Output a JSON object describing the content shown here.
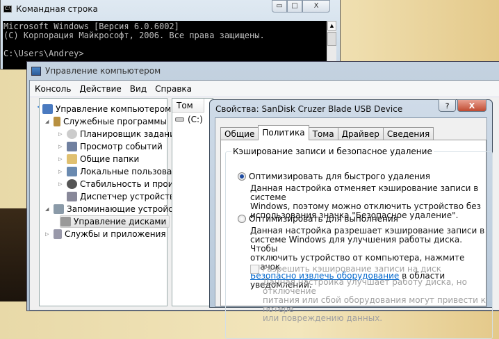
{
  "cmd": {
    "title": "Командная строка",
    "icon_text": "C:\\",
    "lines": [
      "Microsoft Windows [Версия 6.0.6002]",
      "(C) Корпорация Майкрософт, 2006. Все права защищены.",
      "",
      "C:\\Users\\Andrey>"
    ]
  },
  "mgmt": {
    "title": "Управление компьютером",
    "menu": [
      "Консоль",
      "Действие",
      "Вид",
      "Справка"
    ],
    "tree": [
      "Управление компьютером (л",
      "Служебные программы",
      "Планировщик заданий",
      "Просмотр событий",
      "Общие папки",
      "Локальные пользовате",
      "Стабильность и произ",
      "Диспетчер устройств",
      "Запоминающие устройст",
      "Управление дисками",
      "Службы и приложения"
    ],
    "list_header": "Том",
    "list_rows": [
      "(C:)"
    ]
  },
  "dialog": {
    "title": "Свойства: SanDisk Cruzer Blade USB Device",
    "help": "?",
    "close": "X",
    "tabs": [
      "Общие",
      "Политика",
      "Тома",
      "Драйвер",
      "Сведения"
    ],
    "active_tab": "Политика",
    "group_label": "Кэширование записи и безопасное удаление",
    "opt1": "Оптимизировать для быстрого удаления",
    "opt1_desc": [
      "Данная настройка отменяет кэширование записи в системе",
      "Windows, поэтому можно отключить устройство без",
      "использования значка \"Безопасное удаление\"."
    ],
    "opt2": "Оптимизировать для выполнения",
    "opt2_desc": [
      "Данная настройка разрешает кэширование записи в",
      "системе Windows для улучшения работы диска. Чтобы",
      "отключить устройство от компьютера, нажмите значок"
    ],
    "opt2_link": "Безопасно извлечь оборудование",
    "opt2_after_link": " в области уведомлений.",
    "checkbox": "Разрешить кэширование записи на диск",
    "checkbox_desc": [
      "Данная настройка улучшает работу диска, но отключение",
      "питания или сбой оборудования могут привести к потере",
      "или повреждению данных."
    ]
  }
}
